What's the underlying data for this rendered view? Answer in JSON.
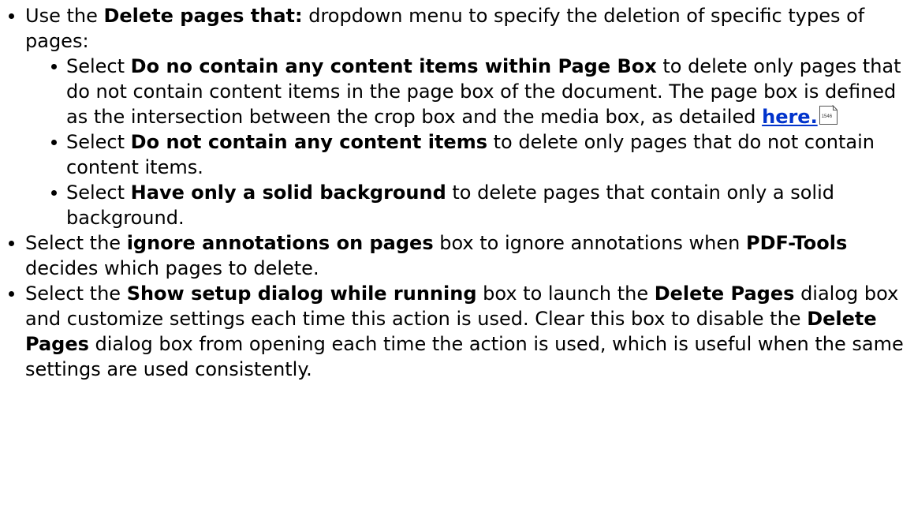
{
  "items": [
    {
      "text_before": "Use the ",
      "bold_1": "Delete pages that:",
      "text_after": " dropdown menu to specify the deletion of specific types of pages:",
      "sub_items": [
        {
          "text_before": "Select ",
          "bold": "Do no contain any content items within Page Box",
          "text_after": " to delete only pages that do not contain content items in the page box of the document. The page box is defined as the intersection between the crop box and the media box, as detailed ",
          "link_text": "here.",
          "link_page_ref": "1546"
        },
        {
          "text_before": "Select ",
          "bold": "Do not contain any content items",
          "text_after": " to delete only pages that do not contain content items."
        },
        {
          "text_before": "Select ",
          "bold": "Have only a solid background",
          "text_after": " to delete pages that contain only a solid background."
        }
      ]
    },
    {
      "text_before": "Select the ",
      "bold_1": "ignore annotations on pages",
      "text_middle": " box to ignore annotations when ",
      "bold_2": "PDF-Tools",
      "text_after": " decides which pages to delete."
    },
    {
      "text_before": "Select the ",
      "bold_1": "Show setup dialog while running",
      "text_middle_1": " box to launch the ",
      "bold_2": "Delete Pages",
      "text_middle_2": " dialog box and customize settings each time this action is used. Clear this box to disable the ",
      "bold_3": "Delete Pages",
      "text_after": " dialog box from opening each time the action is used, which is useful when the same settings are used consistently."
    }
  ]
}
